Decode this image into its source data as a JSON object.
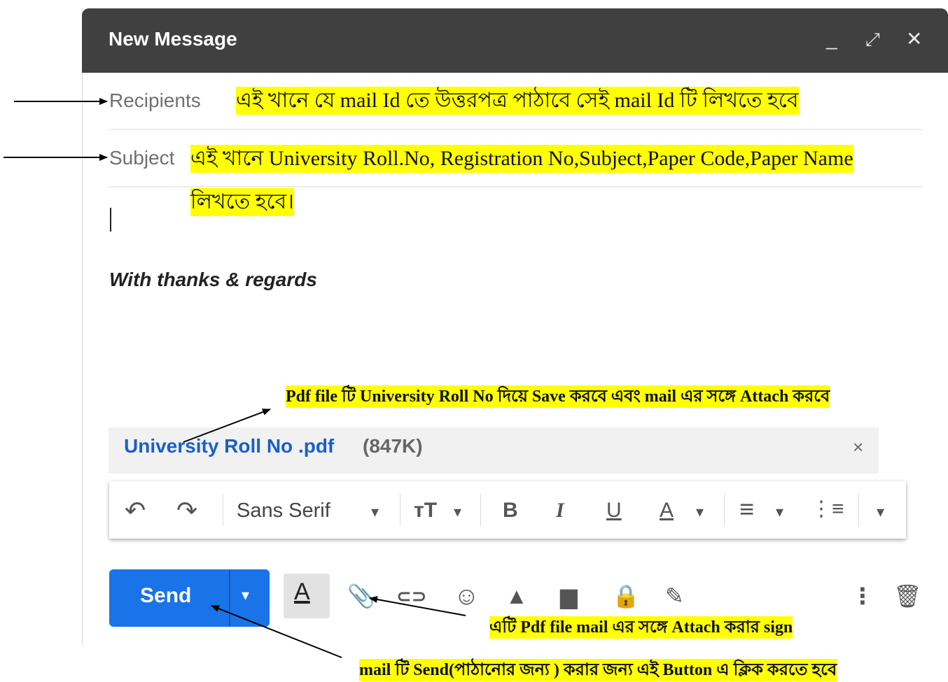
{
  "window": {
    "title": "New Message",
    "minimize_glyph": "_",
    "expand_glyph": "⤢",
    "close_glyph": "✕"
  },
  "fields": {
    "recipients_label": "Recipients",
    "subject_label": "Subject"
  },
  "body": {
    "signature": "With thanks & regards"
  },
  "attachment": {
    "name": "University Roll No .pdf",
    "size": "(847K)",
    "remove_glyph": "×"
  },
  "toolbar": {
    "undo_glyph": "↶",
    "redo_glyph": "↷",
    "font_name": "Sans Serif",
    "dropdown_glyph": "▾",
    "size_glyph": "ᴛT",
    "bold_glyph": "B",
    "italic_glyph": "I",
    "underline_glyph": "U",
    "text_color_glyph": "A",
    "align_glyph": "≡",
    "numbered_list_glyph": "⋮≡",
    "more_glyph": "▾"
  },
  "bottom_bar": {
    "send_label": "Send",
    "send_dropdown_glyph": "▾",
    "formatting_glyph": "A",
    "attach_glyph": "📎",
    "link_glyph": "⊂⊃",
    "emoji_glyph": "☺",
    "drive_glyph": "▲",
    "photo_glyph": "▆",
    "confidential_glyph": "🔒",
    "signature_glyph": "✎",
    "more_options_glyph": "⋮",
    "discard_glyph": "🗑"
  },
  "annotations": {
    "recipients_note": "এই খানে  যে  mail Id তে উত্তরপত্র পাঠাবে সেই mail Id টি লিখতে হবে",
    "subject_note_line1": "এই খানে  University Roll.No, Registration No,Subject,Paper Code,Paper Name",
    "subject_note_line2": "লিখতে হবে।",
    "pdf_note": "Pdf file টি University Roll No দিয়ে Save করবে  এবং mail এর সঙ্গে Attach করবে",
    "attach_note": "এটি Pdf file  mail এর সঙ্গে Attach করার sign",
    "send_note": "mail টি Send(পাঠানোর জন্য ) করার জন্য এই Button এ ক্লিক করতে হবে"
  },
  "colors": {
    "title_bar": "#404040",
    "send_button": "#1a73e8",
    "attachment_link": "#1a5fc8",
    "highlight": "#ffff00"
  }
}
